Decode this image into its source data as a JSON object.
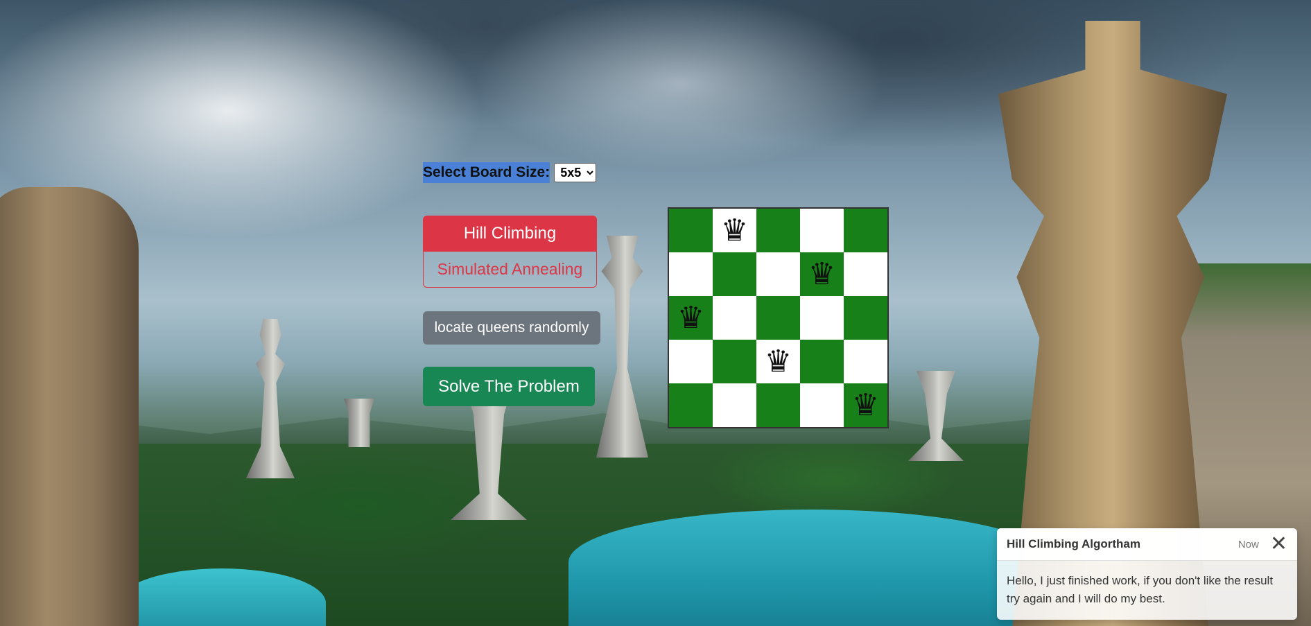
{
  "controls": {
    "board_size_label": "Select Board Size:",
    "board_size_value": "5x5",
    "board_size_options": [
      "5x5"
    ],
    "algorithms": {
      "hill_climbing": "Hill Climbing",
      "simulated_annealing": "Simulated Annealing",
      "selected": "Hill Climbing"
    },
    "randomize_label": "locate queens randomly",
    "solve_label": "Solve The Problem"
  },
  "board": {
    "size": 5,
    "queen_glyph": "♛",
    "queens": [
      {
        "row": 0,
        "col": 1
      },
      {
        "row": 1,
        "col": 3
      },
      {
        "row": 2,
        "col": 0
      },
      {
        "row": 3,
        "col": 2
      },
      {
        "row": 4,
        "col": 4
      }
    ],
    "colors": {
      "dark": "#188018",
      "light": "#ffffff"
    }
  },
  "toast": {
    "title": "Hill Climbing Algortham",
    "time": "Now",
    "message": "Hello, I just finished work, if you don't like the result try again and I will do my best.",
    "close_icon": "close-icon"
  },
  "colors": {
    "hill_climbing": "#dc3545",
    "randomize": "#6c757d",
    "solve": "#198754",
    "label_highlight": "#4a80d6"
  }
}
